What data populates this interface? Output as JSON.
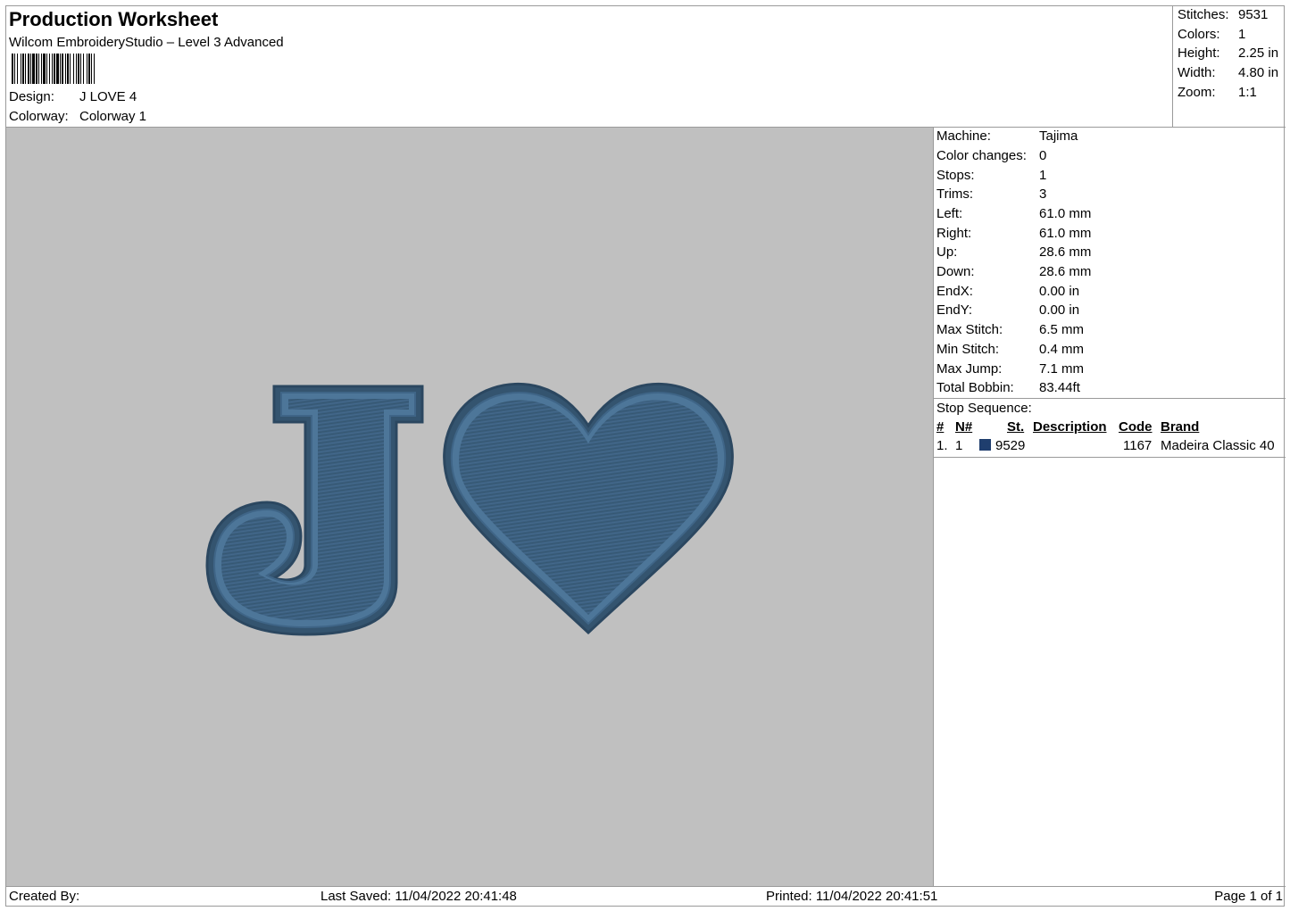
{
  "header": {
    "title": "Production Worksheet",
    "subtitle": "Wilcom EmbroideryStudio – Level 3 Advanced",
    "design_label": "Design:",
    "design_value": "J LOVE 4",
    "colorway_label": "Colorway:",
    "colorway_value": "Colorway 1"
  },
  "stats": [
    {
      "label": "Stitches:",
      "value": "9531"
    },
    {
      "label": "Colors:",
      "value": "1"
    },
    {
      "label": "Height:",
      "value": "2.25 in"
    },
    {
      "label": "Width:",
      "value": "4.80 in"
    },
    {
      "label": "Zoom:",
      "value": "1:1"
    }
  ],
  "machine_info": [
    {
      "label": "Machine:",
      "value": "Tajima"
    },
    {
      "label": "Color changes:",
      "value": "0"
    },
    {
      "label": "Stops:",
      "value": "1"
    },
    {
      "label": "Trims:",
      "value": "3"
    },
    {
      "label": "Left:",
      "value": "61.0 mm"
    },
    {
      "label": "Right:",
      "value": "61.0 mm"
    },
    {
      "label": "Up:",
      "value": "28.6 mm"
    },
    {
      "label": "Down:",
      "value": "28.6 mm"
    },
    {
      "label": "EndX:",
      "value": "0.00 in"
    },
    {
      "label": "EndY:",
      "value": "0.00 in"
    },
    {
      "label": "Max Stitch:",
      "value": "6.5 mm"
    },
    {
      "label": "Min Stitch:",
      "value": "0.4 mm"
    },
    {
      "label": "Max Jump:",
      "value": "7.1 mm"
    },
    {
      "label": "Total Bobbin:",
      "value": "83.44ft"
    }
  ],
  "stop_sequence": {
    "title": "Stop Sequence:",
    "columns": [
      "#",
      "N#",
      "St.",
      "Description",
      "Code",
      "Brand"
    ],
    "rows": [
      {
        "num": "1.",
        "n": "1",
        "st": "9529",
        "description": "",
        "code": "1167",
        "brand": "Madeira Classic 40",
        "color": "#1f3e6e"
      }
    ]
  },
  "design_preview": {
    "background": "#c0c0c0",
    "thread_color": "#3c6283"
  },
  "footer": {
    "created_by": "Created By:",
    "last_saved": "Last Saved: 11/04/2022 20:41:48",
    "printed": "Printed: 11/04/2022 20:41:51",
    "page": "Page 1 of 1"
  }
}
